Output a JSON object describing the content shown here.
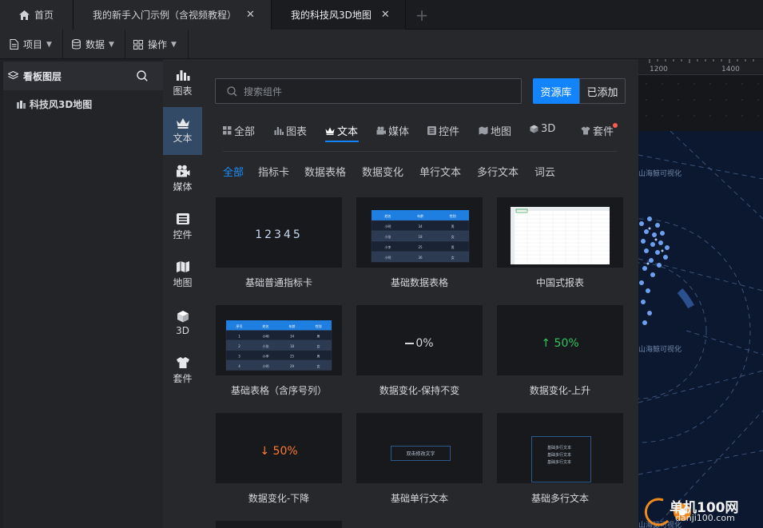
{
  "tabs": {
    "home": "首页",
    "tutorial": "我的新手入门示例（含视频教程）",
    "map": "我的科技风3D地图"
  },
  "toolbar": {
    "project": "项目",
    "data": "数据",
    "operation": "操作"
  },
  "layers": {
    "title": "看板图层",
    "item": "科技风3D地图"
  },
  "categories": [
    "图表",
    "文本",
    "媒体",
    "控件",
    "地图",
    "3D",
    "套件"
  ],
  "search": {
    "placeholder": "搜索组件"
  },
  "buttons": {
    "library": "资源库",
    "added": "已添加"
  },
  "type_tabs": [
    "全部",
    "图表",
    "文本",
    "媒体",
    "控件",
    "地图",
    "3D",
    "套件"
  ],
  "sub_tabs": [
    "全部",
    "指标卡",
    "数据表格",
    "数据变化",
    "单行文本",
    "多行文本",
    "词云"
  ],
  "cards": [
    "基础普通指标卡",
    "基础数据表格",
    "中国式报表",
    "基础表格（含序号列）",
    "数据变化-保持不变",
    "数据变化-上升",
    "数据变化-下降",
    "基础单行文本",
    "基础多行文本"
  ],
  "thumbs": {
    "indicator": "12345",
    "change_flat": "0%",
    "change_up": "50%",
    "change_down": "50%",
    "single_text": "双击修改文字",
    "multi_text": [
      "基础多行文本",
      "基础多行文本",
      "基础多行文本"
    ],
    "table_headers": [
      "姓名",
      "年龄",
      "性别"
    ],
    "table_rows": [
      [
        "小明",
        "34",
        "男"
      ],
      [
        "小张",
        "18",
        "女"
      ],
      [
        "小李",
        "25",
        "男"
      ],
      [
        "小明",
        "36",
        "女"
      ]
    ],
    "seq_headers": [
      "序号",
      "姓名",
      "年龄",
      "性别"
    ],
    "seq_rows": [
      [
        "1",
        "小明",
        "34",
        "男"
      ],
      [
        "2",
        "小张",
        "18",
        "女"
      ],
      [
        "3",
        "小李",
        "25",
        "男"
      ],
      [
        "4",
        "小明",
        "29",
        "女"
      ]
    ]
  },
  "canvas": {
    "ruler": [
      "1200",
      "1400"
    ],
    "watermark": "山海鲸可视化"
  },
  "site": {
    "name": "单机100网",
    "url": "danji100.com"
  }
}
